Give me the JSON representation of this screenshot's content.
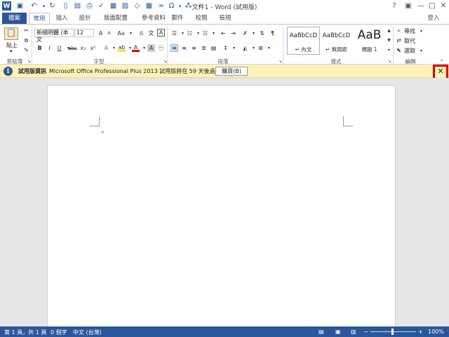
{
  "window": {
    "title": "文件1 - Word (試用版)",
    "help": "?",
    "minimize": "—",
    "maximize": "□",
    "close": "✕",
    "signin": "登入"
  },
  "tabs": [
    "檔案",
    "常用",
    "插入",
    "設計",
    "版面配置",
    "參考資料",
    "郵件",
    "校閱",
    "檢視"
  ],
  "ribbon": {
    "clipboard": {
      "paste": "貼上",
      "label": "剪貼簿"
    },
    "font": {
      "name": "新細明體 (本文",
      "size": "12",
      "label": "字型",
      "bold": "B",
      "italic": "I",
      "underline": "U",
      "strike": "abc",
      "sub": "x₂",
      "sup": "x²"
    },
    "paragraph": {
      "label": "段落"
    },
    "styles": {
      "label": "樣式",
      "items": [
        {
          "sample": "AaBbCcD",
          "name": "↵ 內文"
        },
        {
          "sample": "AaBbCcD",
          "name": "↵ 無間距"
        },
        {
          "sample": "AaB",
          "name": "標題 1"
        }
      ]
    },
    "editing": {
      "find": "尋找",
      "replace": "取代",
      "select": "選取",
      "label": "編輯"
    }
  },
  "message_bar": {
    "title": "試用版資訊",
    "text": "Microsoft Office Professional Plus 2013 試用版將在 59 天後過期。",
    "button": "購買(B)"
  },
  "document": {
    "paragraph_mark": "↵"
  },
  "status": {
    "page": "第 1 頁，共 1 頁",
    "words": "0 個字",
    "language": "中文 (台灣)",
    "zoom": "100%"
  },
  "colors": {
    "brand": "#2b579a",
    "message": "#fdf3b8",
    "highlight": "#e00000"
  }
}
